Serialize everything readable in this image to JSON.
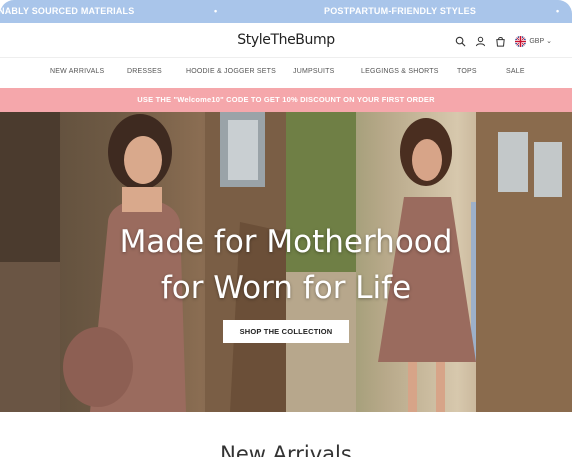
{
  "announcement": {
    "items": [
      "NABLY SOURCED MATERIALS",
      "POSTPARTUM-FRIENDLY STYLES"
    ],
    "separator": "•"
  },
  "header": {
    "logo_text": "StyleTheBump",
    "currency": "GBP",
    "icons": [
      "search-icon",
      "account-icon",
      "cart-icon",
      "uk-flag-icon",
      "chevron-down-icon"
    ]
  },
  "nav": {
    "items": [
      "NEW ARRIVALS",
      "DRESSES",
      "HOODIE & JOGGER SETS",
      "JUMPSUITS",
      "LEGGINGS & SHORTS",
      "TOPS",
      "SALE"
    ]
  },
  "promo": {
    "text": "USE THE \"Welcome10\" CODE TO GET 10% DISCOUNT ON YOUR FIRST ORDER"
  },
  "hero": {
    "title_line1": "Made for Motherhood",
    "title_line2": "for Worn for Life",
    "cta_label": "SHOP THE COLLECTION"
  },
  "section": {
    "title": "New Arrivals"
  },
  "colors": {
    "announcement_bg": "#a9c5ea",
    "promo_bg": "#f5a7ab",
    "dress": "#9a6b5e"
  }
}
